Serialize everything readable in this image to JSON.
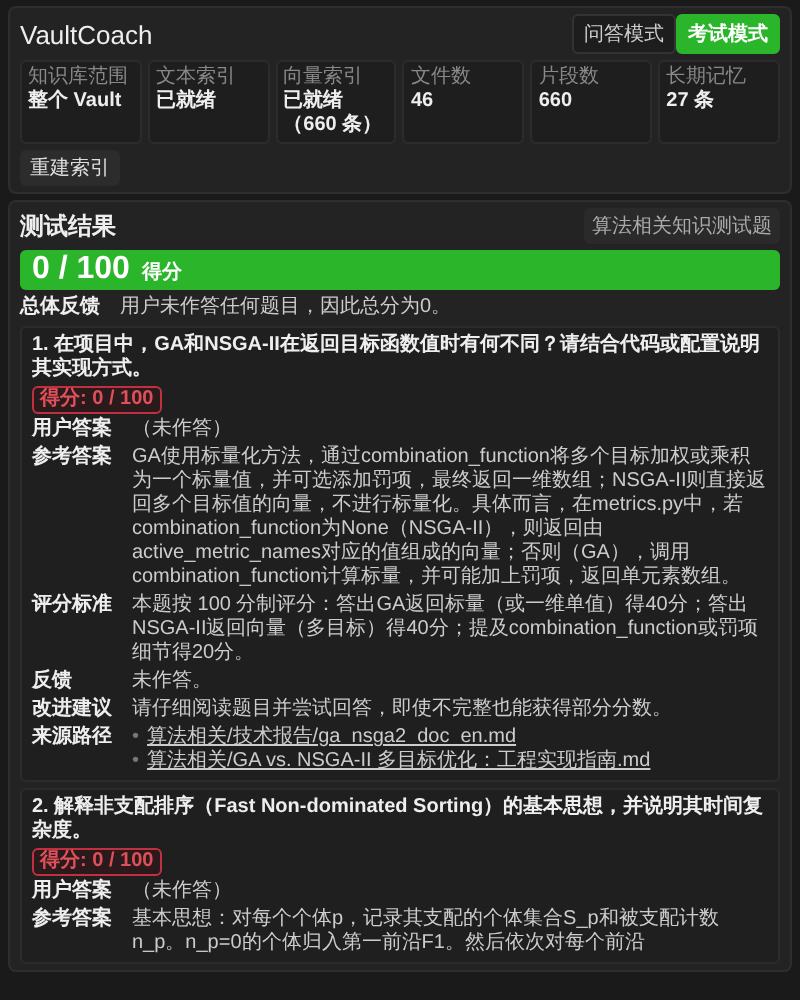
{
  "app": {
    "title": "VaultCoach",
    "modes": [
      {
        "label": "问答模式",
        "selected": false
      },
      {
        "label": "考试模式",
        "selected": true
      }
    ]
  },
  "stats": [
    {
      "label": "知识库范围",
      "value": "整个 Vault"
    },
    {
      "label": "文本索引",
      "value": "已就绪"
    },
    {
      "label": "向量索引",
      "value": "已就绪（660 条）"
    },
    {
      "label": "文件数",
      "value": "46"
    },
    {
      "label": "片段数",
      "value": "660"
    },
    {
      "label": "长期记忆",
      "value": "27 条"
    }
  ],
  "rebuild_button": "重建索引",
  "results": {
    "title": "测试结果",
    "quiz_button": "算法相关知识测试题",
    "score": {
      "value": "0 / 100",
      "unit": "得分"
    },
    "overall": {
      "heading": "总体反馈",
      "text": "用户未作答任何题目，因此总分为0。"
    },
    "questions": [
      {
        "title": "1. 在项目中，GA和NSGA-II在返回目标函数值时有何不同？请结合代码或配置说明其实现方式。",
        "badge": "得分: 0 / 100",
        "sections": [
          {
            "kind": "text",
            "heading": "用户答案",
            "text": "（未作答）"
          },
          {
            "kind": "text",
            "heading": "参考答案",
            "text": "GA使用标量化方法，通过combination_function将多个目标加权或乘积为一个标量值，并可选添加罚项，最终返回一维数组；NSGA-II则直接返回多个目标值的向量，不进行标量化。具体而言，在metrics.py中，若combination_function为None（NSGA-II），则返回由active_metric_names对应的值组成的向量；否则（GA），调用combination_function计算标量，并可能加上罚项，返回单元素数组。"
          },
          {
            "kind": "text",
            "heading": "评分标准",
            "text": "本题按 100 分制评分：答出GA返回标量（或一维单值）得40分；答出NSGA-II返回向量（多目标）得40分；提及combination_function或罚项细节得20分。"
          },
          {
            "kind": "text",
            "heading": "反馈",
            "text": "未作答。"
          },
          {
            "kind": "text",
            "heading": "改进建议",
            "text": "请仔细阅读题目并尝试回答，即使不完整也能获得部分分数。"
          },
          {
            "kind": "links",
            "heading": "来源路径",
            "items": [
              {
                "bullet": "•",
                "text": "算法相关/技术报告/ga_nsga2_doc_en.md"
              },
              {
                "bullet": "•",
                "text": "算法相关/GA vs. NSGA-II 多目标优化：工程实现指南.md"
              }
            ]
          }
        ]
      },
      {
        "title": "2. 解释非支配排序（Fast Non-dominated Sorting）的基本思想，并说明其时间复杂度。",
        "badge": "得分: 0 / 100",
        "sections": [
          {
            "kind": "text",
            "heading": "用户答案",
            "text": "（未作答）"
          },
          {
            "kind": "text",
            "heading": "参考答案",
            "text": "基本思想：对每个个体p，记录其支配的个体集合S_p和被支配计数n_p。n_p=0的个体归入第一前沿F1。然后依次对每个前沿"
          }
        ]
      }
    ]
  }
}
